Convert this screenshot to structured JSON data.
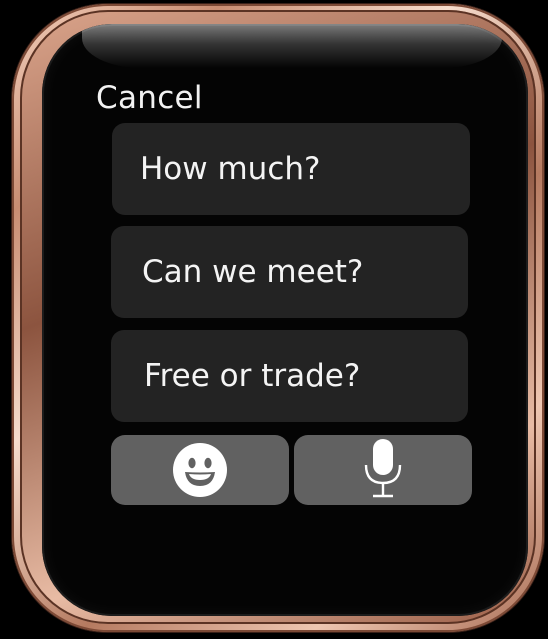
{
  "screen": {
    "cancel_label": "Cancel"
  },
  "quick_replies": [
    {
      "label": "How much?"
    },
    {
      "label": "Can we meet?"
    },
    {
      "label": "Free or trade?"
    }
  ],
  "actions": {
    "emoji_icon": "smiley-face-icon",
    "dictation_icon": "microphone-icon"
  },
  "colors": {
    "case": "#c98d72",
    "reply_background": "#232323",
    "action_background": "#616161",
    "text": "#f4f4f4"
  }
}
